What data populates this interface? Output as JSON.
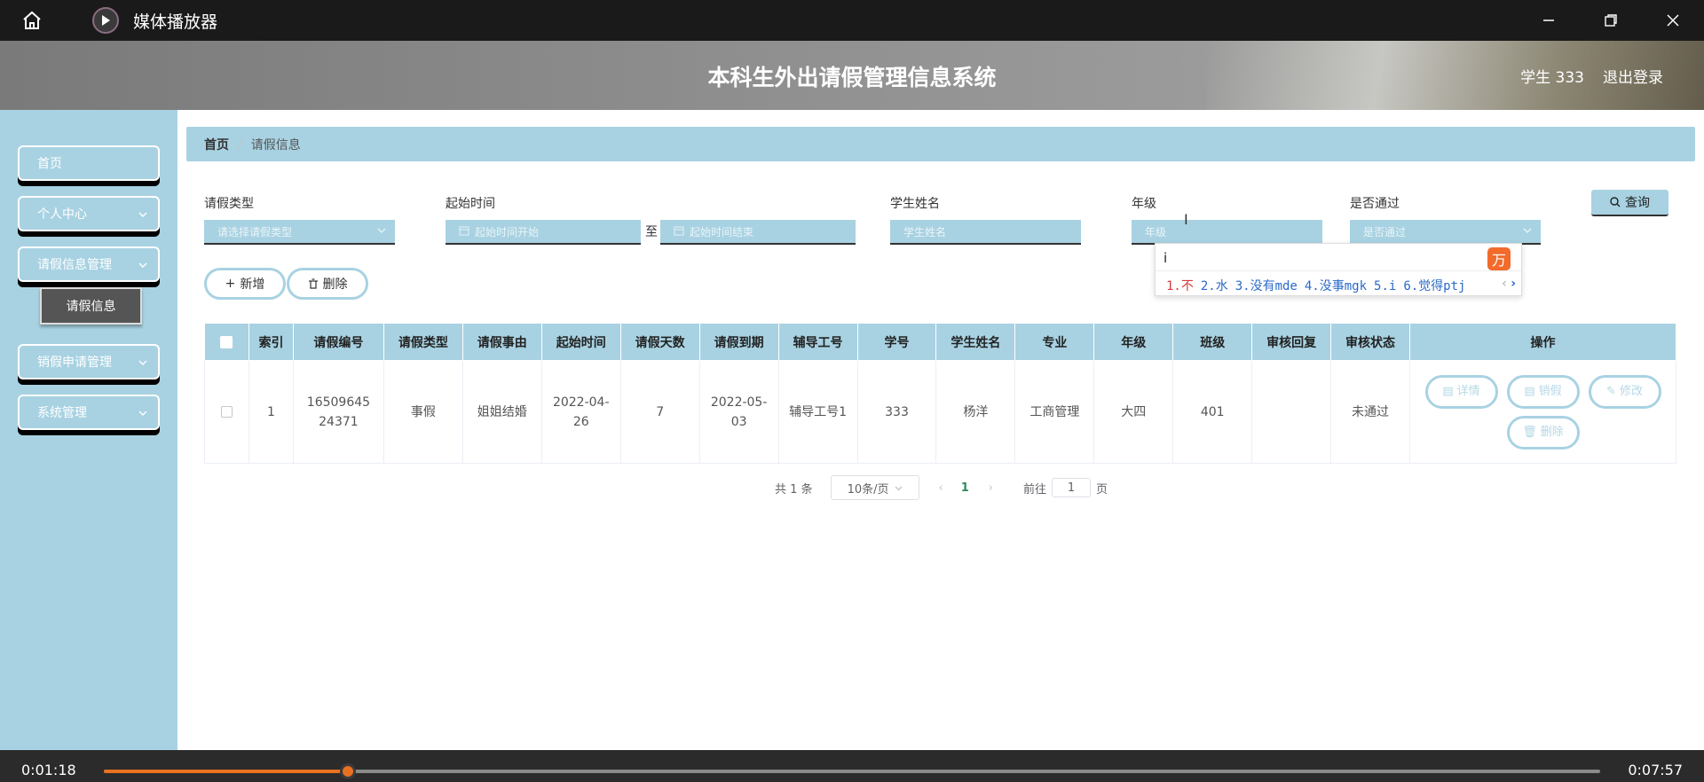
{
  "window": {
    "title": "媒体播放器"
  },
  "header": {
    "title": "本科生外出请假管理信息系统",
    "user": "学生 333",
    "logout": "退出登录"
  },
  "sidebar": {
    "items": [
      {
        "label": "首页"
      },
      {
        "label": "个人中心"
      },
      {
        "label": "请假信息管理"
      },
      {
        "label": "销假申请管理"
      },
      {
        "label": "系统管理"
      }
    ],
    "sub_item": "请假信息"
  },
  "breadcrumb": {
    "home": "首页",
    "separator": "/",
    "current": "请假信息"
  },
  "filters": {
    "leave_type": {
      "label": "请假类型",
      "placeholder": "请选择请假类型"
    },
    "start_time": {
      "label": "起始时间",
      "from_placeholder": "起始时间开始",
      "to": "至",
      "to_placeholder": "起始时间结束"
    },
    "student_name": {
      "label": "学生姓名",
      "placeholder": "学生姓名"
    },
    "grade": {
      "label": "年级",
      "placeholder": "年级"
    },
    "approved": {
      "label": "是否通过",
      "placeholder": "是否通过"
    },
    "query_label": "查询"
  },
  "ime": {
    "input": "i",
    "candidates": [
      "1.不",
      "2.水",
      "3.没有mde",
      "4.没事mgk",
      "5.i",
      "6.觉得ptj"
    ]
  },
  "actions": {
    "add": "新增",
    "delete": "删除"
  },
  "table": {
    "columns": [
      "索引",
      "请假编号",
      "请假类型",
      "请假事由",
      "起始时间",
      "请假天数",
      "请假到期",
      "辅导工号",
      "学号",
      "学生姓名",
      "专业",
      "年级",
      "班级",
      "审核回复",
      "审核状态",
      "操作"
    ],
    "rows": [
      {
        "index": "1",
        "leave_no": "1650964524371",
        "type": "事假",
        "reason": "姐姐结婚",
        "start": "2022-04-26",
        "days": "7",
        "end": "2022-05-03",
        "tutor_id": "辅导工号1",
        "student_id": "333",
        "name": "杨洋",
        "major": "工商管理",
        "grade": "大四",
        "class": "401",
        "reply": "",
        "status": "未通过"
      }
    ],
    "row_actions": {
      "detail": "详情",
      "cancel": "销假",
      "edit": "修改",
      "delete": "删除"
    }
  },
  "pagination": {
    "total": "共 1 条",
    "page_size": "10条/页",
    "current_page": "1",
    "goto_prefix": "前往",
    "goto_value": "1",
    "goto_suffix": "页"
  },
  "player": {
    "current_time": "0:01:18",
    "duration": "0:07:57",
    "progress_fraction": 0.163
  },
  "colors": {
    "accent": "#a8d2e2",
    "progress": "#e8711f",
    "titlebar": "#1a1a1a"
  }
}
